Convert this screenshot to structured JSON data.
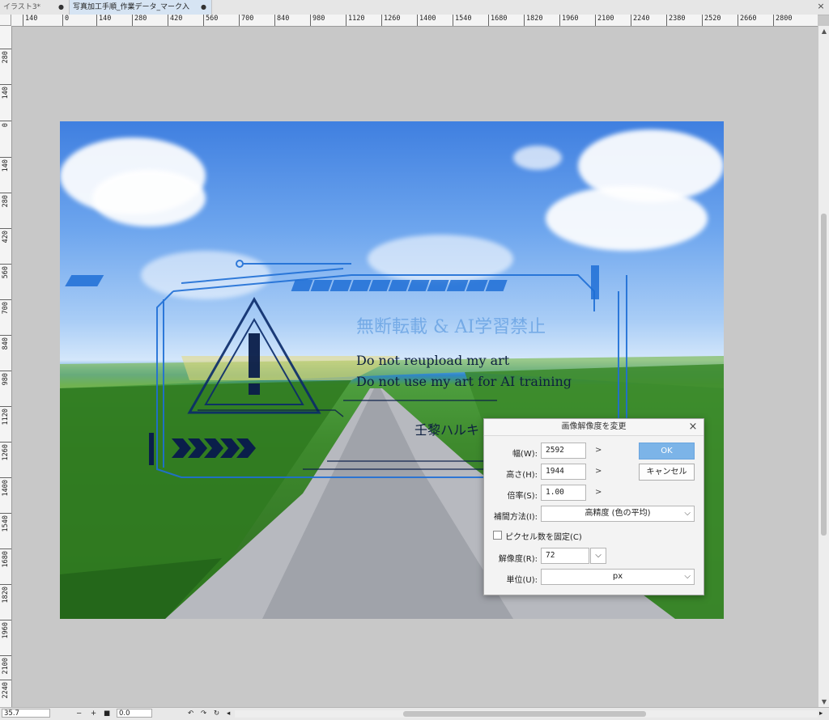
{
  "tabs": [
    {
      "label": "イラスト3*",
      "modified_dot": "●"
    },
    {
      "label": "写真加工手順_作業データ_マーク入り.jpg*",
      "modified_dot": "●"
    }
  ],
  "ruler": {
    "top": [
      "140",
      "0",
      "140",
      "280",
      "420",
      "560",
      "700",
      "840",
      "980",
      "1120",
      "1260",
      "1400",
      "1540",
      "1680",
      "1820",
      "1960",
      "2100",
      "2240",
      "2380",
      "2520",
      "2660",
      "2800"
    ],
    "left": [
      "280",
      "140",
      "0",
      "140",
      "280",
      "420",
      "560",
      "700",
      "840",
      "980",
      "1120",
      "1260",
      "1400",
      "1540",
      "1680",
      "1820",
      "1960",
      "2100",
      "2240"
    ]
  },
  "watermark": {
    "title_jp": "無断転載 & AI学習禁止",
    "line1": "Do not reupload my art",
    "line2": "Do not use my art for AI training",
    "signature": "壬黎ハルキ"
  },
  "dialog": {
    "title": "画像解像度を変更",
    "width_label": "幅(W):",
    "width_value": "2592",
    "height_label": "高さ(H):",
    "height_value": "1944",
    "scale_label": "倍率(S):",
    "scale_value": "1.00",
    "ok_label": "OK",
    "cancel_label": "キャンセル",
    "interp_label": "補間方法(I):",
    "interp_value": "高精度 (色の平均)",
    "fix_pixels_label": "ピクセル数を固定(C)",
    "resolution_label": "解像度(R):",
    "resolution_value": "72",
    "unit_label": "単位(U):",
    "unit_value": "px"
  },
  "status": {
    "zoom": "35.7",
    "zoom_out": "−",
    "zoom_in": "+",
    "angle": "0.0"
  },
  "colors": {
    "accent": "#7cb4e8",
    "watermark_line": "#1f6fd6"
  }
}
